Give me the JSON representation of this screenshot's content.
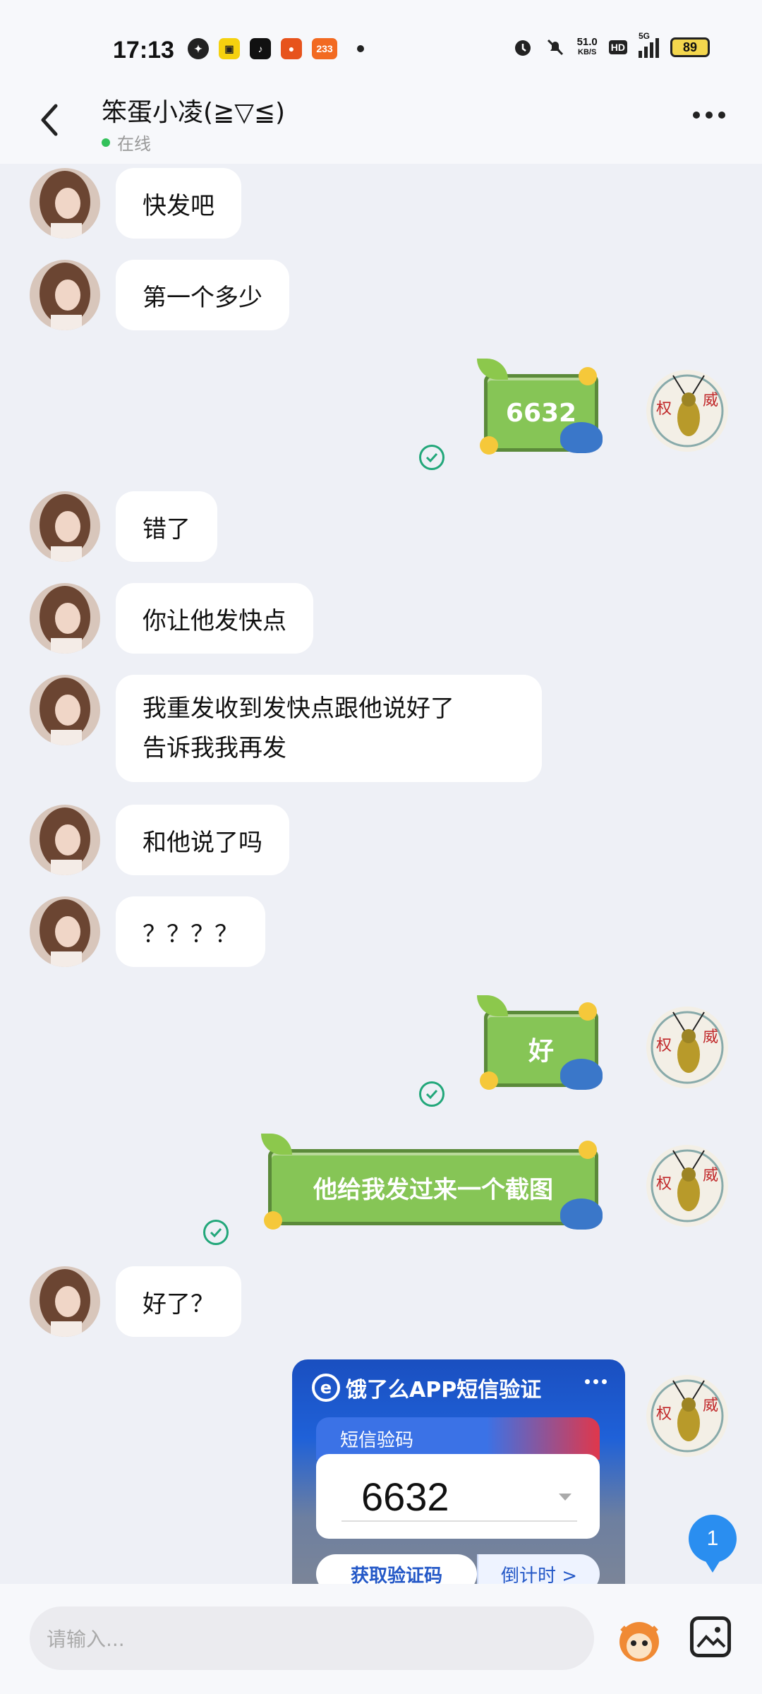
{
  "status": {
    "time": "17:13",
    "net_speed_value": "51.0",
    "net_speed_unit": "KB/S",
    "hd": "HD",
    "network": "5G",
    "battery": "89",
    "app_badge_233": "233"
  },
  "header": {
    "contact_name": "笨蛋小凌(≧▽≦)",
    "presence": "在线"
  },
  "messages": {
    "m1": "快发吧",
    "m2": "第一个多少",
    "s1": "6632",
    "m3": "错了",
    "m4": "你让他发快点",
    "m5_line1": "我重发收到发快点跟他说好了",
    "m5_line2": "告诉我我再发",
    "m6": "和他说了吗",
    "m7": "？？？？",
    "s2": "好",
    "s3": "他给我发过来一个截图",
    "m8": "好了？"
  },
  "card": {
    "title": "饿了么APP短信验证",
    "label": "短信验码",
    "code": "6632",
    "get_button": "获取验证码",
    "countdown_button": "倒计时 >"
  },
  "scroll_badge": "1",
  "input": {
    "placeholder": "请输入..."
  },
  "colors": {
    "sticker_green": "#86c556",
    "read_check": "#22a77a",
    "online": "#33c15a",
    "badge_blue": "#2a8ef0"
  }
}
